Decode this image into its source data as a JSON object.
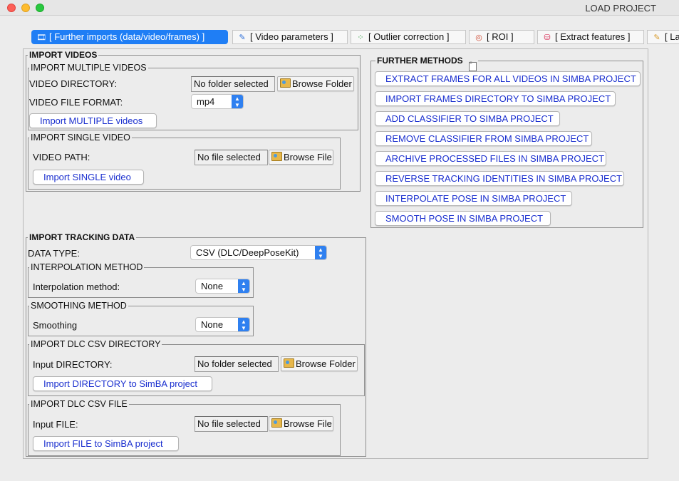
{
  "window": {
    "title": "LOAD PROJECT"
  },
  "tabs": [
    {
      "label": "[ Further imports (data/video/frames) ]",
      "icon": "film-icon"
    },
    {
      "label": "[ Video parameters ]",
      "icon": "pen-icon"
    },
    {
      "label": "[ Outlier correction ]",
      "icon": "scatter-icon"
    },
    {
      "label": "[ ROI ]",
      "icon": "roi-icon"
    },
    {
      "label": "[ Extract features ]",
      "icon": "database-icon"
    },
    {
      "label": "[ La",
      "icon": "label-icon"
    }
  ],
  "import_videos": {
    "title": "IMPORT VIDEOS",
    "multiple": {
      "title": "IMPORT MULTIPLE VIDEOS",
      "dir_label": "VIDEO DIRECTORY:",
      "dir_value": "No folder selected",
      "browse_label": "Browse Folder",
      "format_label": "VIDEO FILE FORMAT:",
      "format_value": "mp4",
      "import_button": "Import MULTIPLE videos"
    },
    "single": {
      "title": "IMPORT SINGLE VIDEO",
      "path_label": "VIDEO PATH:",
      "path_value": "No file selected",
      "browse_label": "Browse File",
      "import_button": "Import SINGLE video"
    }
  },
  "further_methods": {
    "title": "FURTHER METHODS",
    "buttons": [
      "EXTRACT FRAMES FOR ALL VIDEOS IN SIMBA PROJECT",
      "IMPORT FRAMES DIRECTORY TO SIMBA PROJECT",
      "ADD CLASSIFIER TO SIMBA PROJECT",
      "REMOVE CLASSIFIER FROM SIMBA PROJECT",
      "ARCHIVE PROCESSED FILES IN SIMBA PROJECT",
      "REVERSE TRACKING IDENTITIES IN SIMBA PROJECT",
      "INTERPOLATE POSE IN SIMBA PROJECT",
      "SMOOTH POSE IN SIMBA PROJECT"
    ]
  },
  "tracking": {
    "title": "IMPORT TRACKING DATA",
    "data_type_label": "DATA TYPE:",
    "data_type_value": "CSV (DLC/DeepPoseKit)",
    "interpolation": {
      "title": "INTERPOLATION METHOD",
      "label": "Interpolation method:",
      "value": "None"
    },
    "smoothing": {
      "title": "SMOOTHING METHOD",
      "label": "Smoothing",
      "value": "None"
    },
    "csv_dir": {
      "title": "IMPORT DLC CSV DIRECTORY",
      "label": "Input DIRECTORY:",
      "value": "No folder selected",
      "browse_label": "Browse Folder",
      "import_button": "Import DIRECTORY to SimBA project"
    },
    "csv_file": {
      "title": "IMPORT DLC CSV FILE",
      "label": "Input FILE:",
      "value": "No file selected",
      "browse_label": "Browse File",
      "import_button": "Import FILE to SimBA project"
    }
  },
  "colors": {
    "accent": "#1f7ef5",
    "button_text": "#1a2fcf",
    "background": "#ececec"
  }
}
